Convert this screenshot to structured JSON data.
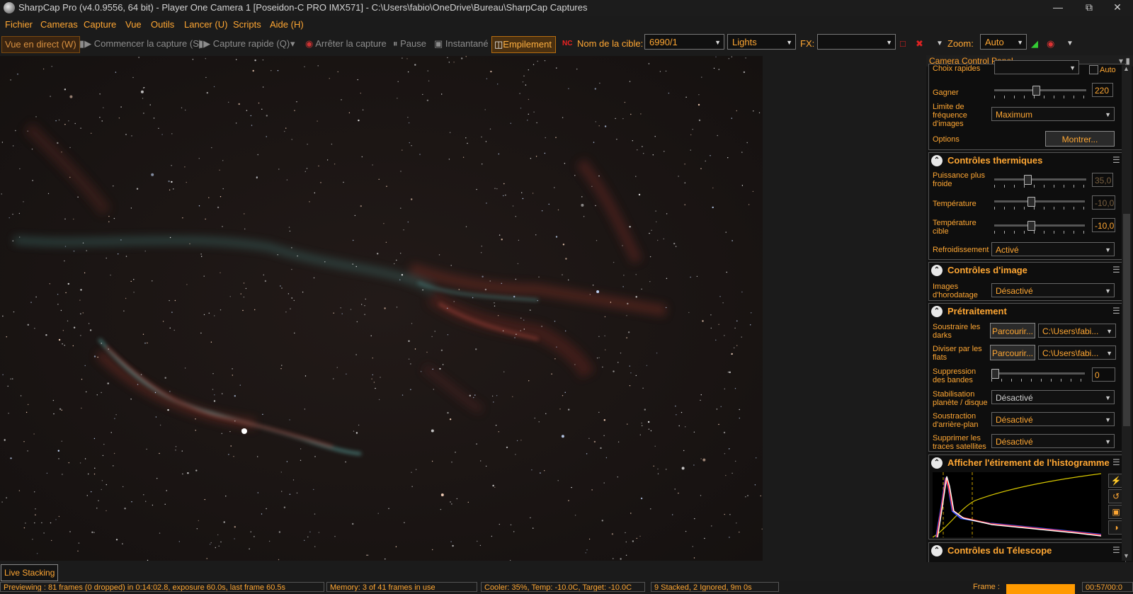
{
  "window": {
    "title": "SharpCap Pro (v4.0.9556, 64 bit) - Player One Camera 1 [Poseidon-C PRO IMX571] - C:\\Users\\fabio\\OneDrive\\Bureau\\SharpCap Captures"
  },
  "menu": [
    "Fichier",
    "Cameras",
    "Capture",
    "Vue",
    "Outils",
    "Lancer (U)",
    "Scripts",
    "Aide (H)"
  ],
  "toolbar": {
    "live_view": "Vue en direct (W)",
    "start_capture": "Commencer la capture (S)",
    "quick_capture": "Capture rapide (Q)",
    "stop_capture": "Arrêter la capture",
    "pause": "Pause",
    "snapshot": "Instantané",
    "stacking": "Empilement",
    "target_label": "Nom de la cible:",
    "target_value": "6990/1",
    "frame_type": "Lights",
    "fx_label": "FX:",
    "fx_value": "",
    "zoom_label": "Zoom:",
    "zoom_value": "Auto"
  },
  "panel": {
    "header": "Camera Control Panel",
    "top": {
      "choix_label": "Choix rapides",
      "auto_label": "Auto",
      "gain_label": "Gagner",
      "gain_value": "220",
      "gain_level": 0.45,
      "fps_label": "Limite de fréquence d'images",
      "fps_value": "Maximum",
      "options_label": "Options",
      "options_button": "Montrer..."
    },
    "thermal": {
      "title": "Contrôles thermiques",
      "cooler_label": "Puissance plus froide",
      "cooler_value": "35,0",
      "cooler_level": 0.35,
      "temp_label": "Température",
      "temp_value": "-10,0",
      "temp_level": 0.4,
      "target_label": "Température cible",
      "target_value": "-10,0",
      "target_level": 0.4,
      "cooling_label": "Refroidissement",
      "cooling_value": "Activé"
    },
    "image": {
      "title": "Contrôles d'image",
      "timestamp_label": "Images d'horodatage",
      "timestamp_value": "Désactivé"
    },
    "preprocessing": {
      "title": "Prétraitement",
      "darks_label": "Soustraire les darks",
      "darks_button": "Parcourir...",
      "darks_path": "C:\\Users\\fabi...",
      "flats_label": "Diviser par les flats",
      "flats_button": "Parcourir...",
      "flats_path": "C:\\Users\\fabi...",
      "banding_label": "Suppression des bandes",
      "banding_value": "0",
      "banding_level": 0,
      "stab_label": "Stabilisation planète / disque",
      "stab_value": "Désactivé",
      "bg_label": "Soustraction d'arrière-plan",
      "bg_value": "Désactivé",
      "sat_label": "Supprimer les traces satellites",
      "sat_value": "Désactivé"
    },
    "histogram": {
      "title": "Afficher l'étirement de l'histogramme"
    },
    "telescope": {
      "title": "Contrôles du Télescope"
    }
  },
  "bottom_tab": "Live Stacking",
  "status": {
    "preview": "Previewing : 81 frames (0 dropped) in 0:14:02.8, exposure 60.0s, last frame 60.5s",
    "memory": "Memory: 3 of 41 frames in use",
    "cooler": "Cooler: 35%, Temp: -10.0C, Target: -10.0C",
    "stacked": "9 Stacked, 2 Ignored, 9m 0s",
    "frame_label": "Frame :",
    "time": "00:57/00:0"
  },
  "colors": {
    "accent": "#ffa733",
    "background": "#141414"
  }
}
